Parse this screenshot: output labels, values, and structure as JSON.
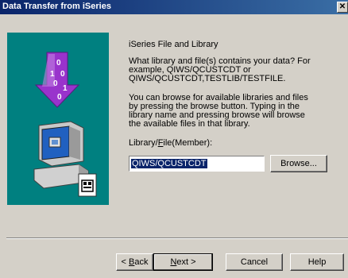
{
  "window": {
    "title": "Data Transfer from iSeries",
    "close_glyph": "✕"
  },
  "content": {
    "heading": "iSeries File and Library",
    "paragraph1": "What library and file(s) contains your data?  For example, QIWS/QCUSTCDT or QIWS/QCUSTCDT,TESTLIB/TESTFILE.",
    "paragraph2": "You can browse for available libraries and files by pressing the browse button.  Typing in the library name and pressing browse will browse the available files in that library.",
    "field_label_prefix": "Library/",
    "field_label_mnemonic": "F",
    "field_label_suffix": "ile(Member):",
    "library_value": "QIWS/QCUSTCDT"
  },
  "buttons": {
    "browse": "Browse...",
    "back_prefix": "< ",
    "back_mnemonic": "B",
    "back_suffix": "ack",
    "next_mnemonic": "N",
    "next_suffix": "ext >",
    "cancel": "Cancel",
    "help": "Help"
  },
  "illustration": {
    "binary_digits": [
      "0",
      "1",
      "0",
      "0",
      "1",
      "0"
    ],
    "arrow_color": "#9933cc",
    "panel_color": "#008080"
  }
}
